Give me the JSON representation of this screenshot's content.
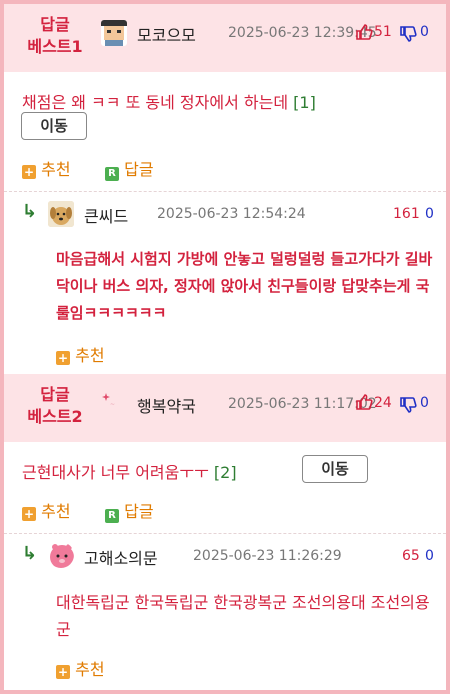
{
  "posts": [
    {
      "best_label": "답글\n베스트1",
      "best_line1": "답글",
      "best_line2": "베스트1",
      "nickname": "모코으모",
      "date": "2025-06-23 12:39:45",
      "up_count": "51",
      "down_count": "0",
      "title": "채점은 왜 ㅋㅋ 또 동네 정자에서 하는데",
      "reply_count": "[1]",
      "move_label": "이동",
      "recommend_label": "추천",
      "reply_label": "답글",
      "reply": {
        "nickname": "큰씨드",
        "date": "2025-06-23 12:54:24",
        "up_count": "161",
        "down_count": "0",
        "text": "마음급해서 시험지 가방에 안놓고 덜렁덜렁 들고가다가 길바닥이나 버스 의자, 정자에 앉아서 친구들이랑 답맞추는게 국룰임ㅋㅋㅋㅋㅋㅋ",
        "recommend_label": "추천"
      }
    },
    {
      "best_line1": "답글",
      "best_line2": "베스트2",
      "nickname": "행복약국",
      "date": "2025-06-23 11:17:02",
      "up_count": "24",
      "down_count": "0",
      "title": "근현대사가 너무 어려움ㅜㅜ",
      "reply_count": "[2]",
      "move_label": "이동",
      "recommend_label": "추천",
      "reply_label": "답글",
      "reply": {
        "nickname": "고해소의문",
        "date": "2025-06-23 11:26:29",
        "up_count": "65",
        "down_count": "0",
        "text": "대한독립군 한국독립군 한국광복군 조선의용대 조선의용군",
        "recommend_label": "추천"
      }
    }
  ],
  "icons": {
    "plus": "+",
    "r": "R",
    "reply_arrow": "↳"
  },
  "colors": {
    "accent_red": "#d3223e",
    "header_bg": "#fde3e6",
    "frame": "#f4b6bd",
    "down_blue": "#1f2fc5",
    "count_green": "#2e7d32",
    "action_orange": "#e07b00"
  }
}
